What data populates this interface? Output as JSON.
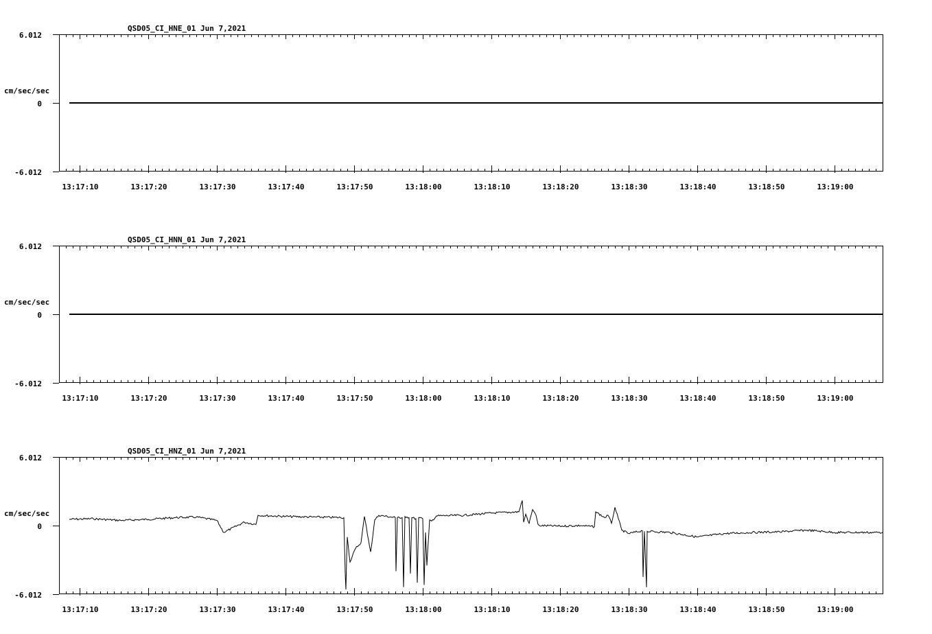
{
  "chart_data": [
    {
      "type": "line",
      "title": "QSD05_CI_HNE_01  Jun 7,2021",
      "ylabel": "cm/sec/sec",
      "ytick_labels": [
        "6.012",
        "0",
        "-6.012"
      ],
      "ylim": [
        -6.012,
        6.012
      ],
      "xtick_labels": [
        "13:17:10",
        "13:17:20",
        "13:17:30",
        "13:17:40",
        "13:17:50",
        "13:18:00",
        "13:18:10",
        "13:18:20",
        "13:18:30",
        "13:18:40",
        "13:18:50",
        "13:19:00"
      ],
      "xlim_seconds_after_13_17_00": [
        7,
        127
      ],
      "series": [
        {
          "x": [
            8.5,
            127
          ],
          "y": [
            0,
            0
          ]
        }
      ]
    },
    {
      "type": "line",
      "title": "QSD05_CI_HNN_01  Jun 7,2021",
      "ylabel": "cm/sec/sec",
      "ytick_labels": [
        "6.012",
        "0",
        "-6.012"
      ],
      "ylim": [
        -6.012,
        6.012
      ],
      "xtick_labels": [
        "13:17:10",
        "13:17:20",
        "13:17:30",
        "13:17:40",
        "13:17:50",
        "13:18:00",
        "13:18:10",
        "13:18:20",
        "13:18:30",
        "13:18:40",
        "13:18:50",
        "13:19:00"
      ],
      "xlim_seconds_after_13_17_00": [
        7,
        127
      ],
      "series": [
        {
          "x": [
            8.5,
            127
          ],
          "y": [
            0,
            0
          ]
        }
      ]
    },
    {
      "type": "line",
      "title": "QSD05_CI_HNZ_01  Jun 7,2021",
      "ylabel": "cm/sec/sec",
      "ytick_labels": [
        "6.012",
        "0",
        "-6.012"
      ],
      "ylim": [
        -6.012,
        6.012
      ],
      "xtick_labels": [
        "13:17:10",
        "13:17:20",
        "13:17:30",
        "13:17:40",
        "13:17:50",
        "13:18:00",
        "13:18:10",
        "13:18:20",
        "13:18:30",
        "13:18:40",
        "13:18:50",
        "13:19:00"
      ],
      "xlim_seconds_after_13_17_00": [
        7,
        127
      ],
      "series": [
        {
          "x": [
            8.5,
            12,
            16,
            20,
            24,
            27,
            30,
            31,
            34,
            35.7,
            36,
            40,
            44,
            48.5,
            48.7,
            48.8,
            48.9,
            49,
            49.4,
            50.2,
            51,
            51.5,
            52.4,
            52.6,
            53,
            53.6,
            56,
            56.1,
            56.3,
            57,
            57.2,
            57.4,
            58,
            58.2,
            58.4,
            59,
            59.2,
            59.4,
            60,
            60.2,
            60.4,
            60.6,
            61,
            61.3,
            62,
            66,
            70,
            74,
            74.5,
            74.7,
            75,
            75.5,
            76,
            76.5,
            76.8,
            77,
            80,
            83,
            85,
            85.2,
            86.5,
            87,
            87.5,
            88,
            88.5,
            89,
            90,
            92,
            92.1,
            92.3,
            92.6,
            92.7,
            96,
            100,
            104,
            108,
            112,
            116,
            120,
            127
          ],
          "y": [
            0.55,
            0.6,
            0.45,
            0.55,
            0.7,
            0.75,
            0.45,
            -0.6,
            0.3,
            0.1,
            0.9,
            0.8,
            0.75,
            0.7,
            -4.2,
            -5.6,
            -3.0,
            -1.0,
            -3.2,
            -2.0,
            -1.5,
            0.8,
            -2.3,
            -1.5,
            0.5,
            0.9,
            0.7,
            -4.0,
            0.7,
            0.7,
            -5.4,
            0.8,
            0.7,
            -4.2,
            0.7,
            0.6,
            -5.0,
            0.7,
            0.6,
            -5.2,
            -0.6,
            -3.5,
            0.5,
            0.4,
            0.85,
            0.9,
            1.1,
            1.2,
            2.2,
            0.3,
            1.0,
            0.2,
            1.4,
            0.9,
            0.1,
            0.0,
            -0.05,
            0.0,
            -0.1,
            1.2,
            0.7,
            0.9,
            0.2,
            1.6,
            0.6,
            -0.4,
            -0.7,
            -0.45,
            -4.5,
            -0.5,
            -5.4,
            -0.5,
            -0.6,
            -1.0,
            -0.7,
            -0.6,
            -0.55,
            -0.4,
            -0.6,
            -0.6
          ]
        }
      ]
    }
  ]
}
